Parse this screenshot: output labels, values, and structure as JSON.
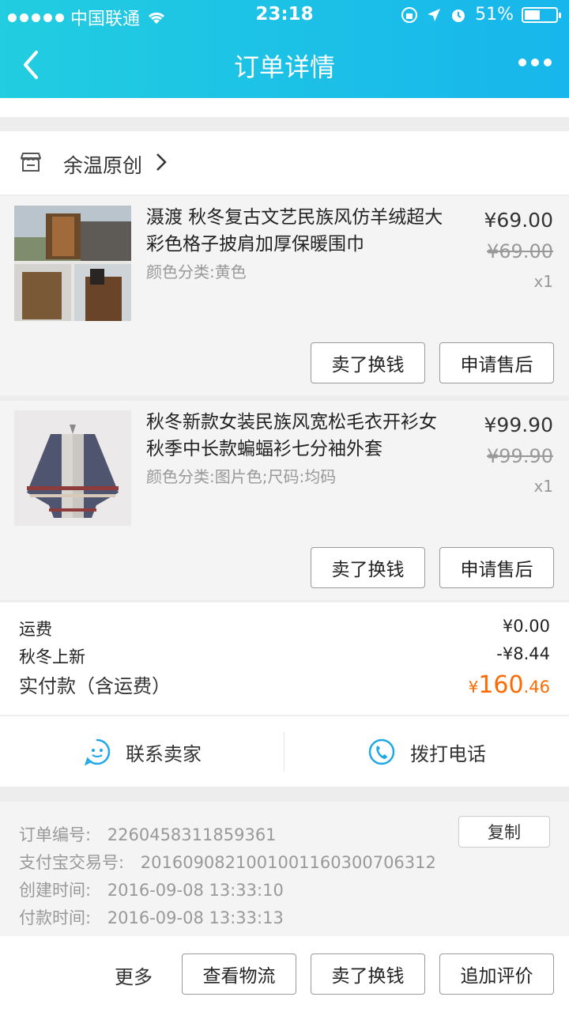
{
  "status_bar": {
    "carrier": "中国联通",
    "time": "23:18",
    "battery": "51%",
    "battery_level": 0.51
  },
  "nav": {
    "title": "订单详情"
  },
  "shop": {
    "name": "余温原创"
  },
  "items": [
    {
      "title": "滠渡 秋冬复古文艺民族风仿羊绒超大彩色格子披肩加厚保暖围巾",
      "spec": "颜色分类:黄色",
      "price": "¥69.00",
      "original_price": "¥69.00",
      "quantity": "x1",
      "button_sell": "卖了换钱",
      "button_aftersale": "申请售后"
    },
    {
      "title": "秋冬新款女装民族风宽松毛衣开衫女 秋季中长款蝙蝠衫七分袖外套",
      "spec": "颜色分类:图片色;尺码:均码",
      "price": "¥99.90",
      "original_price": "¥99.90",
      "quantity": "x1",
      "button_sell": "卖了换钱",
      "button_aftersale": "申请售后"
    }
  ],
  "summary": {
    "shipping_label": "运费",
    "shipping_value": "¥0.00",
    "promo_label": "秋冬上新",
    "promo_value": "-¥8.44",
    "total_label": "实付款（含运费）",
    "total_currency": "¥",
    "total_integer": "160",
    "total_decimal": ".46"
  },
  "contact": {
    "seller": "联系卖家",
    "phone": "拨打电话"
  },
  "order_info": {
    "order_no_label": "订单编号:",
    "order_no": "2260458311859361",
    "copy": "复制",
    "alipay_label": "支付宝交易号:",
    "alipay_no": "2016090821001001160300706312",
    "created_label": "创建时间:",
    "created": "2016-09-08 13:33:10",
    "paid_label": "付款时间:",
    "paid": "2016-09-08 13:33:13"
  },
  "bottom_bar": {
    "more": "更多",
    "logistics": "查看物流",
    "sell": "卖了换钱",
    "review": "追加评价"
  },
  "colors": {
    "header_start": "#22cde0",
    "header_end": "#17b6ec",
    "total_price": "#ff6a00",
    "contact_icon": "#21a8e6"
  }
}
